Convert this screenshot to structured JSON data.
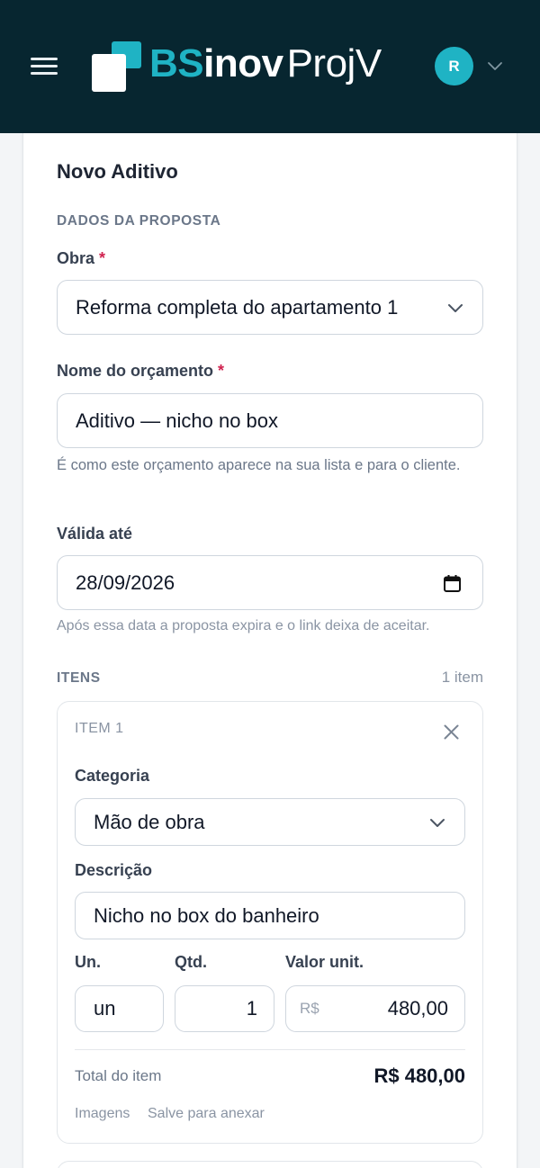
{
  "header": {
    "logo": {
      "part1": "BS",
      "part2": "inov",
      "part3": "ProjV"
    },
    "avatar_initial": "R"
  },
  "form": {
    "title": "Novo Aditivo",
    "section_proposal": "DADOS DA PROPOSTA",
    "obra": {
      "label": "Obra",
      "required_mark": "*",
      "value": "Reforma completa do apartamento 1"
    },
    "nome": {
      "label": "Nome do orçamento",
      "required_mark": "*",
      "value": "Aditivo — nicho no box",
      "hint": "É como este orçamento aparece na sua lista e para o cliente."
    },
    "validade": {
      "label": "Válida até",
      "value": "28/09/2026",
      "hint": "Após essa data a proposta expira e o link deixa de aceitar."
    },
    "itens": {
      "section": "ITENS",
      "count": "1 item",
      "list": [
        {
          "heading": "ITEM 1",
          "categoria_label": "Categoria",
          "categoria_value": "Mão de obra",
          "descricao_label": "Descrição",
          "descricao_value": "Nicho no box do banheiro",
          "un_label": "Un.",
          "un_value": "un",
          "qtd_label": "Qtd.",
          "qtd_value": "1",
          "valor_label": "Valor unit.",
          "currency_prefix": "R$",
          "valor_value": "480,00",
          "total_label": "Total do item",
          "total_value": "R$ 480,00",
          "images_label": "Imagens",
          "images_hint": "Salve para anexar"
        }
      ]
    }
  },
  "colors": {
    "header_bg": "#072630",
    "brand_teal": "#1fb3c4",
    "required": "#d0224f"
  }
}
